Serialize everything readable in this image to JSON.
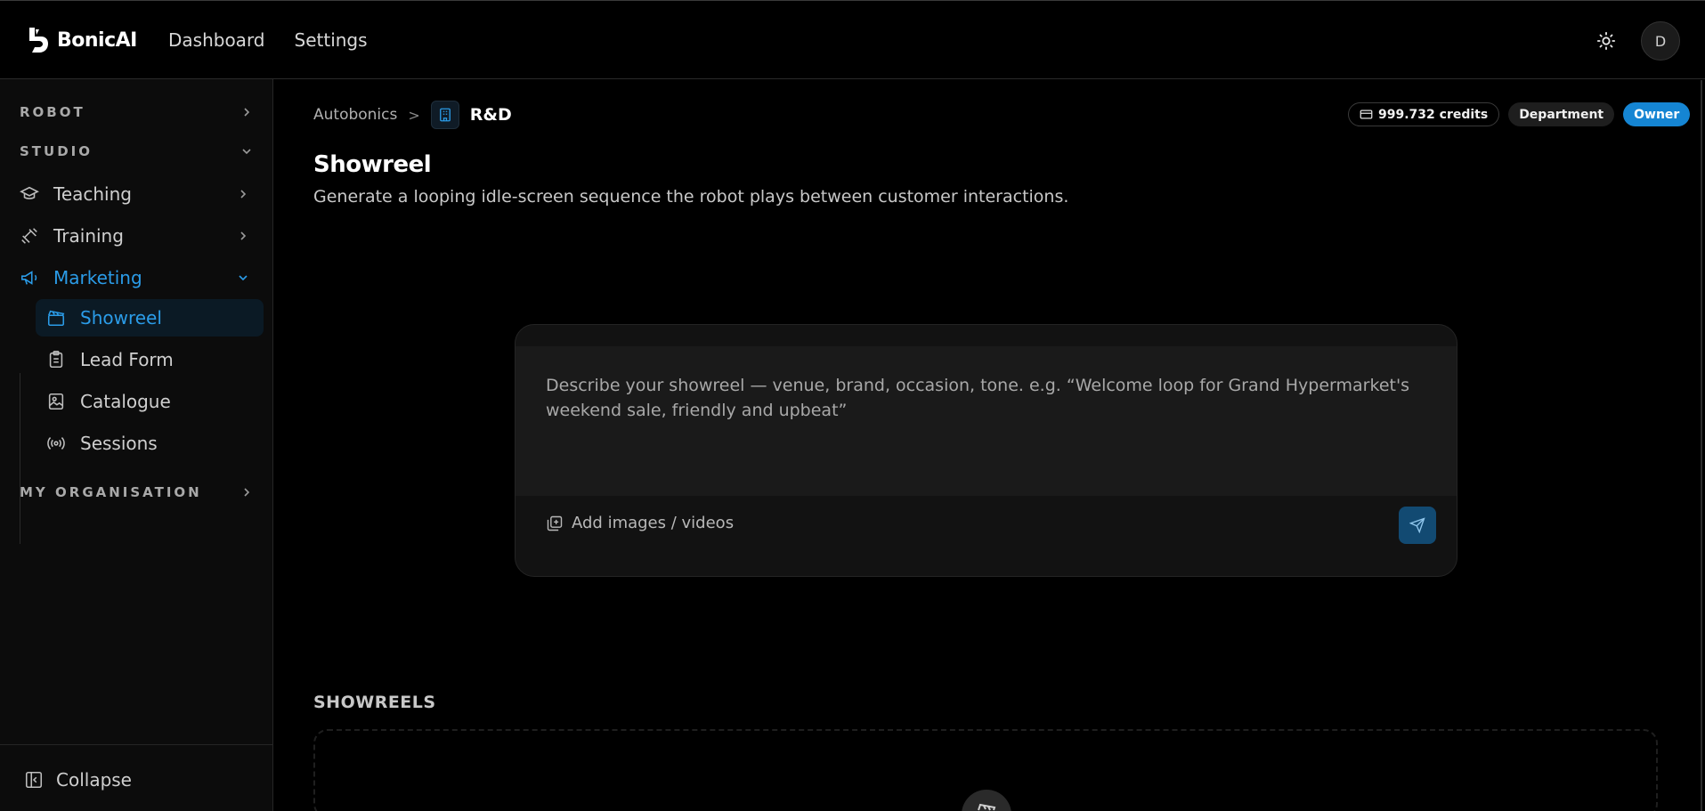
{
  "app": {
    "name": "BonicAI"
  },
  "topnav": {
    "dashboard": "Dashboard",
    "settings": "Settings"
  },
  "user": {
    "initial": "D"
  },
  "sidebar": {
    "robot": "ROBOT",
    "studio": "STUDIO",
    "teaching": "Teaching",
    "training": "Training",
    "marketing": "Marketing",
    "sub": {
      "showreel": "Showreel",
      "lead_form": "Lead Form",
      "catalogue": "Catalogue",
      "sessions": "Sessions"
    },
    "my_organisation": "MY ORGANISATION",
    "collapse": "Collapse"
  },
  "breadcrumb": {
    "root": "Autobonics",
    "sep": ">",
    "current": "R&D"
  },
  "badges": {
    "credits": "999.732 credits",
    "department": "Department",
    "role": "Owner"
  },
  "page": {
    "title": "Showreel",
    "subtitle": "Generate a looping idle-screen sequence the robot plays between customer interactions."
  },
  "composer": {
    "placeholder": "Describe your showreel — venue, brand, occasion, tone. e.g. “Welcome loop for Grand Hypermarket's weekend sale, friendly and upbeat”",
    "attach_label": "Add images / videos"
  },
  "showreels": {
    "heading": "SHOWREELS"
  },
  "colors": {
    "accent": "#2b9ce8",
    "owner_badge": "#1585d3",
    "send_button": "#124a72"
  }
}
